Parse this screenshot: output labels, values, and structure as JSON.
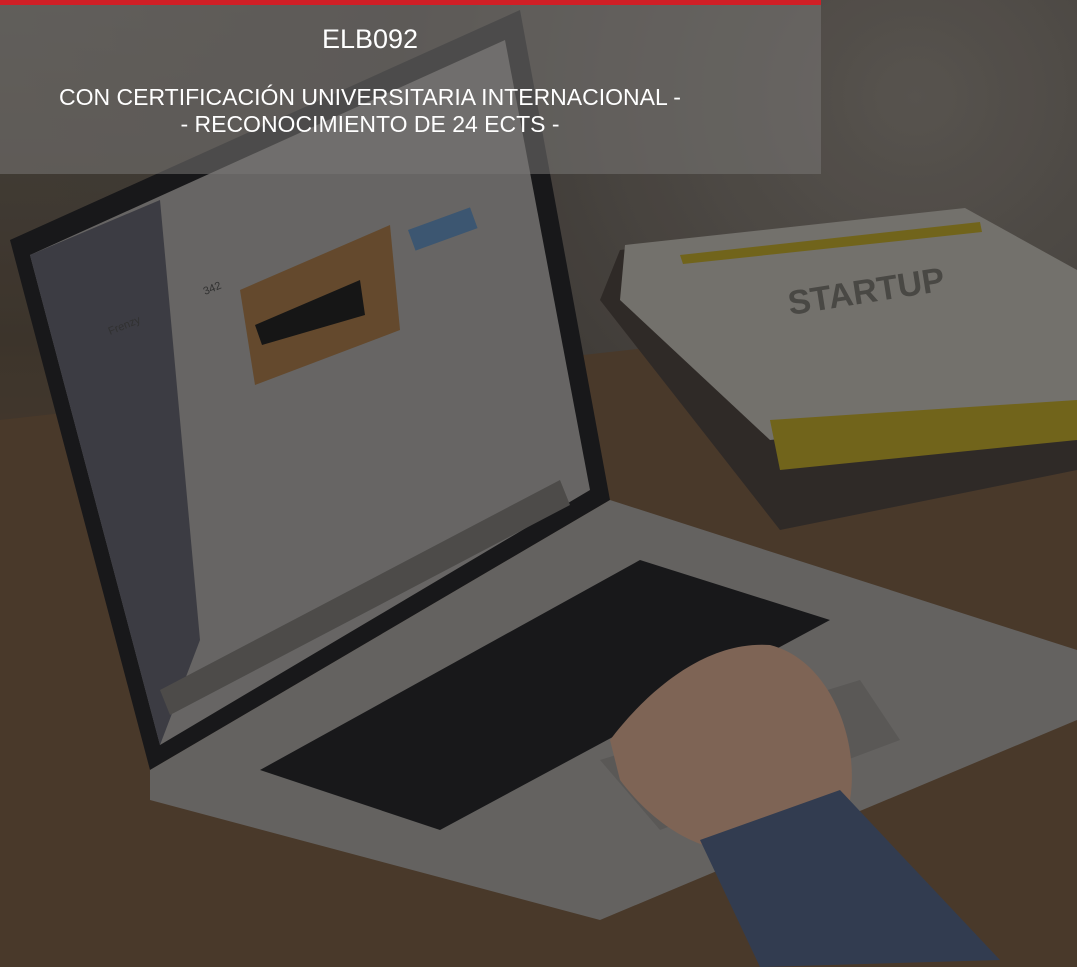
{
  "banner": {
    "code": "ELB092",
    "subtitle_line1": "CON CERTIFICACIÓN UNIVERSITARIA INTERNACIONAL -",
    "subtitle_line2": "- RECONOCIMIENTO DE 24 ECTS -",
    "accent_color": "#d01f26"
  },
  "photo": {
    "book_cover_text": "STARTUP",
    "screen_profile_name": "Frenzy",
    "screen_stat": "342"
  }
}
